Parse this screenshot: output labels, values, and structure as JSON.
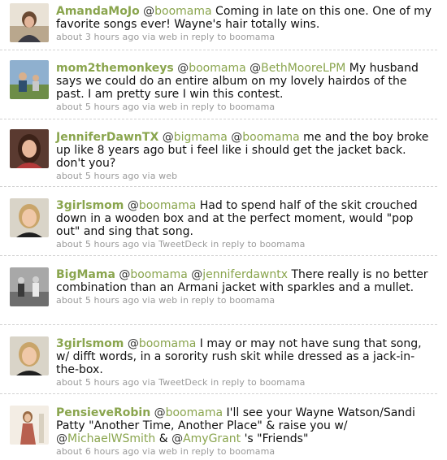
{
  "tweets": [
    {
      "username": "AmandaMoJo",
      "mentions": [
        "boomama"
      ],
      "text": "Coming in late on this one. One of my favorite songs ever! Wayne's hair totally wins.",
      "time": "about 3 hours ago",
      "via_label": "via",
      "source": "web",
      "reply_label": "in reply to",
      "reply_to": "boomama",
      "avatar_icon": "user-photo-icon"
    },
    {
      "username": "mom2themonkeys",
      "mentions": [
        "boomama",
        "BethMooreLPM"
      ],
      "text": "My husband says we could do an entire album on my lovely hairdos of the past. I am pretty sure I win this contest.",
      "time": "about 5 hours ago",
      "via_label": "via",
      "source": "web",
      "reply_label": "in reply to",
      "reply_to": "boomama",
      "avatar_icon": "user-photo-icon"
    },
    {
      "username": "JenniferDawnTX",
      "mentions": [
        "bigmama",
        "boomama"
      ],
      "text": "me and the boy broke up like 8 years ago but i feel like i should get the jacket back. don't you?",
      "time": "about 5 hours ago",
      "via_label": "via",
      "source": "web",
      "reply_label": "",
      "reply_to": "",
      "avatar_icon": "user-photo-icon"
    },
    {
      "username": "3girlsmom",
      "mentions": [
        "boomama"
      ],
      "text": "Had to spend half of the skit crouched down in a wooden box and at the perfect moment, would \"pop out\" and sing that song.",
      "time": "about 5 hours ago",
      "via_label": "via",
      "source": "TweetDeck",
      "reply_label": "in reply to",
      "reply_to": "boomama",
      "avatar_icon": "user-photo-icon"
    },
    {
      "username": "BigMama",
      "mentions": [
        "boomama",
        "jenniferdawntx"
      ],
      "text": "There really is no better combination than an Armani jacket with sparkles and a mullet.",
      "time": "about 5 hours ago",
      "via_label": "via",
      "source": "web",
      "reply_label": "in reply to",
      "reply_to": "boomama",
      "avatar_icon": "user-photo-icon"
    },
    {
      "username": "3girlsmom",
      "mentions": [
        "boomama"
      ],
      "text": "I may or may not have sung that song, w/ difft words, in a sorority rush skit while dressed as a jack-in-the-box.",
      "time": "about 5 hours ago",
      "via_label": "via",
      "source": "TweetDeck",
      "reply_label": "in reply to",
      "reply_to": "boomama",
      "avatar_icon": "user-photo-icon"
    },
    {
      "username": "PensieveRobin",
      "mentions": [
        "boomama"
      ],
      "text_before": "I'll see your Wayne Watson/Sandi Patty \"Another Time, Another Place\" & raise you w/",
      "inline_mentions": [
        "MichaelWSmith",
        "AmyGrant"
      ],
      "inline_joiner": "&",
      "text_after": "'s \"Friends\"",
      "time": "about 6 hours ago",
      "via_label": "via",
      "source": "web",
      "reply_label": "in reply to",
      "reply_to": "boomama",
      "avatar_icon": "user-photo-icon"
    }
  ],
  "colors": {
    "link": "#8aa54e",
    "meta": "#9a9a9a",
    "text": "#111111",
    "divider": "#d2d2d2"
  }
}
